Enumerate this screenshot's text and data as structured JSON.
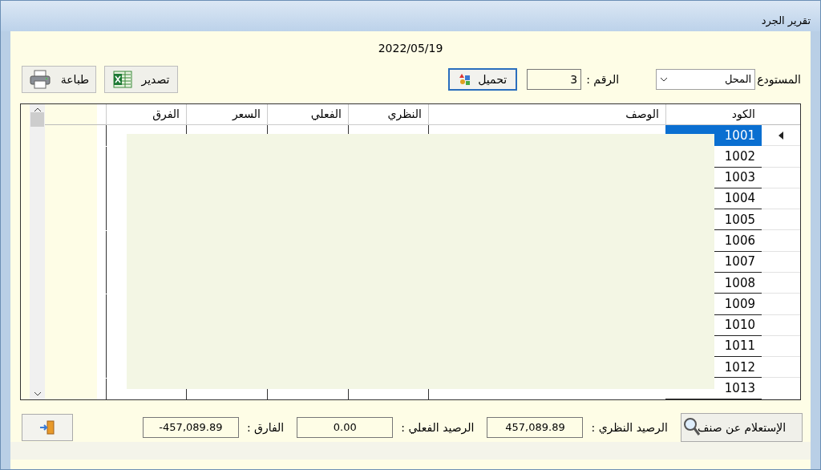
{
  "window": {
    "title": "تقرير الجرد"
  },
  "date": "2022/05/19",
  "filters": {
    "warehouse_label": "المستودع",
    "warehouse_value": "المحل",
    "number_label": "الرقم :",
    "number_value": "3",
    "load_button": "تحميل"
  },
  "toolbar": {
    "export_button": "تصدير",
    "print_button": "طباعة"
  },
  "table": {
    "columns": [
      "الكود",
      "الوصف",
      "النظري",
      "الفعلي",
      "السعر",
      "الفرق"
    ],
    "rows": [
      {
        "code": "1001",
        "selected": true
      },
      {
        "code": "1002",
        "selected": false
      },
      {
        "code": "1003",
        "selected": false
      },
      {
        "code": "1004",
        "selected": false
      },
      {
        "code": "1005",
        "selected": false
      },
      {
        "code": "1006",
        "selected": false
      },
      {
        "code": "1007",
        "selected": false
      },
      {
        "code": "1008",
        "selected": false
      },
      {
        "code": "1009",
        "selected": false
      },
      {
        "code": "1010",
        "selected": false
      },
      {
        "code": "1011",
        "selected": false
      },
      {
        "code": "1012",
        "selected": false
      },
      {
        "code": "1013",
        "selected": false
      }
    ]
  },
  "search_button": "الإستعلام عن صنف",
  "totals": [
    {
      "label": "الرصيد النظري :",
      "value": "457,089.89"
    },
    {
      "label": "الرصيد الفعلي :",
      "value": "0.00"
    },
    {
      "label": "الفارق :",
      "value": "457,089.89-"
    }
  ]
}
